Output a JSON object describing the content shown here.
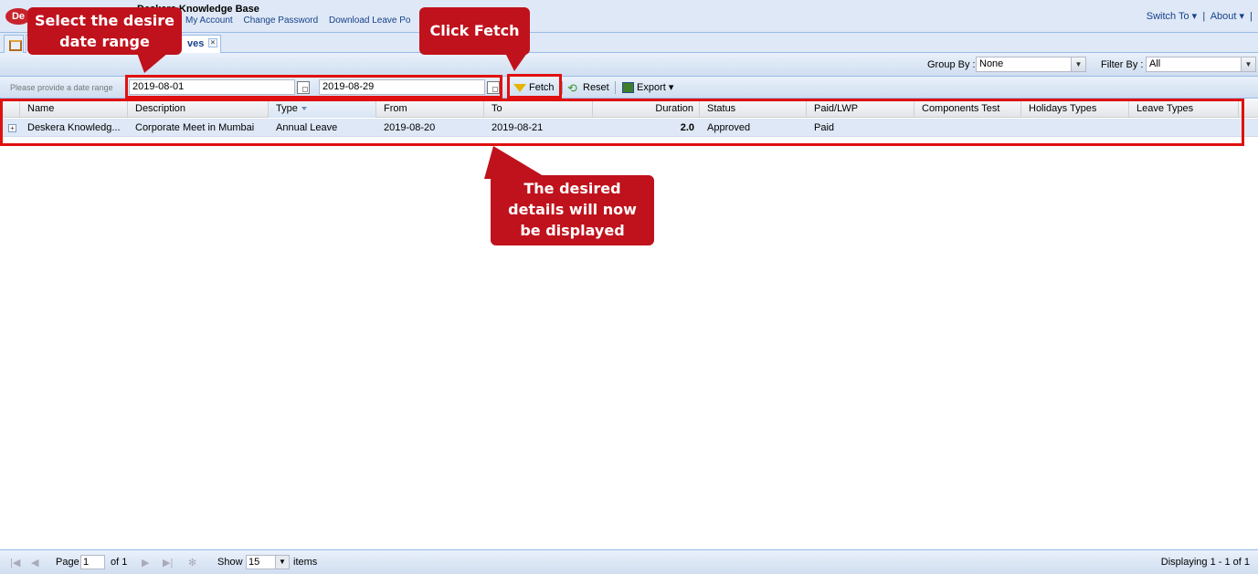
{
  "header": {
    "logo": "De",
    "app_title": "Deskera Knowledge Base",
    "links": [
      "My Account",
      "Change Password",
      "Download Leave Po"
    ],
    "switch_to": "Switch To ▾",
    "about": "About ▾"
  },
  "tabs": {
    "active_label": "ves",
    "close": "×"
  },
  "toolbar1": {
    "group_by_label": "Group By :",
    "group_by_value": "None",
    "filter_by_label": "Filter By :",
    "filter_by_value": "All"
  },
  "toolbar2": {
    "hint": "Please provide a date range",
    "from_date": "2019-08-01",
    "to_date": "2019-08-29",
    "fetch": "Fetch",
    "reset": "Reset",
    "export": "Export ▾"
  },
  "grid": {
    "columns": [
      "Name",
      "Description",
      "Type",
      "From",
      "To",
      "Duration",
      "Status",
      "Paid/LWP",
      "Components Test",
      "Holidays Types",
      "Leave Types"
    ],
    "rows": [
      {
        "name": "Deskera Knowledg...",
        "description": "Corporate Meet in Mumbai",
        "type": "Annual Leave",
        "from": "2019-08-20",
        "to": "2019-08-21",
        "duration": "2.0",
        "status": "Approved",
        "paid": "Paid"
      }
    ]
  },
  "pager": {
    "page_label": "Page",
    "page_value": "1",
    "of_label": "of 1",
    "show_label": "Show",
    "show_value": "15",
    "items_label": "items",
    "displaying": "Displaying 1 - 1 of 1"
  },
  "annotations": {
    "select_range_line1": "Select the desire",
    "select_range_line2": "date range",
    "click_fetch": "Click Fetch",
    "details_line1": "The desired",
    "details_line2": "details will now",
    "details_line3": "be displayed"
  },
  "colors": {
    "accent_red": "#c0121c",
    "highlight_border": "#e01010",
    "header_bg": "#dfe8f6"
  }
}
